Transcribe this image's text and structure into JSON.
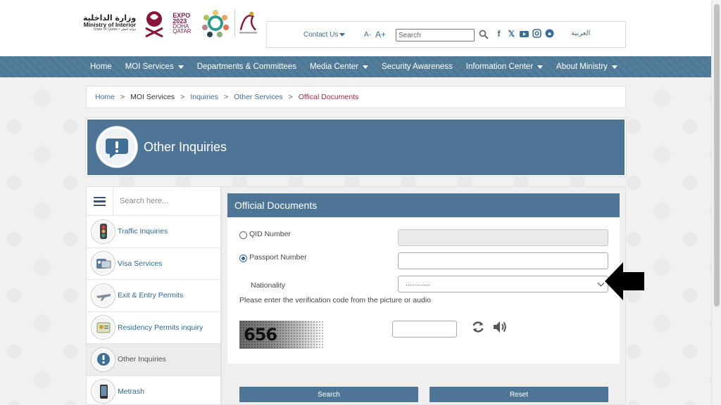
{
  "header": {
    "moi_arabic": "وزارة الداخلية",
    "moi_english": "Ministry of Interior",
    "moi_subtitle": "State of Qatar • دولة قطر",
    "expo_line1": "EXPO",
    "expo_line2": "2023",
    "expo_line3": "DOHA",
    "expo_line4": "QATAR",
    "contact_us": "Contact Us",
    "font_decrease": "A-",
    "font_increase": "A+",
    "search_placeholder": "Search",
    "social_icons": [
      "facebook-icon",
      "x-icon",
      "youtube-icon",
      "instagram-icon",
      "snapchat-icon"
    ],
    "language_link": "العربية"
  },
  "nav": {
    "items": [
      {
        "label": "Home",
        "dropdown": false
      },
      {
        "label": "MOI Services",
        "dropdown": true
      },
      {
        "label": "Departments & Committees",
        "dropdown": false
      },
      {
        "label": "Media Center",
        "dropdown": true
      },
      {
        "label": "Security Awareness",
        "dropdown": false
      },
      {
        "label": "Information Center",
        "dropdown": true
      },
      {
        "label": "About Ministry",
        "dropdown": true
      }
    ]
  },
  "breadcrumb": {
    "items": [
      "Home",
      "MOI Services",
      "Inquiries",
      "Other Services",
      "Offical Documents"
    ],
    "separator": ">"
  },
  "banner": {
    "title": "Other Inquiries"
  },
  "sidebar": {
    "search_placeholder": "Search here...",
    "items": [
      {
        "label": "Traffic Inquiries",
        "icon": "traffic-light-icon",
        "active": false
      },
      {
        "label": "Visa Services",
        "icon": "visa-icon",
        "active": false
      },
      {
        "label": "Exit & Entry Permits",
        "icon": "airplane-icon",
        "active": false
      },
      {
        "label": "Residency Permits inquiry",
        "icon": "residency-card-icon",
        "active": false
      },
      {
        "label": "Other Inquiries",
        "icon": "exclamation-icon",
        "active": true
      },
      {
        "label": "Metrash",
        "icon": "phone-icon",
        "active": false
      }
    ]
  },
  "form": {
    "title": "Official Documents",
    "qid_label": "QID Number",
    "passport_label": "Passport Number",
    "nationality_label": "Nationality",
    "nationality_value": "............",
    "instruction": "Please enter the verification code from the picture or audio",
    "captcha_text": "656",
    "search_button": "Search",
    "reset_button": "Reset",
    "selected_option": "passport"
  },
  "colors": {
    "primary": "#4f7596",
    "link": "#2f6898",
    "current_breadcrumb": "#9b2d3e"
  }
}
